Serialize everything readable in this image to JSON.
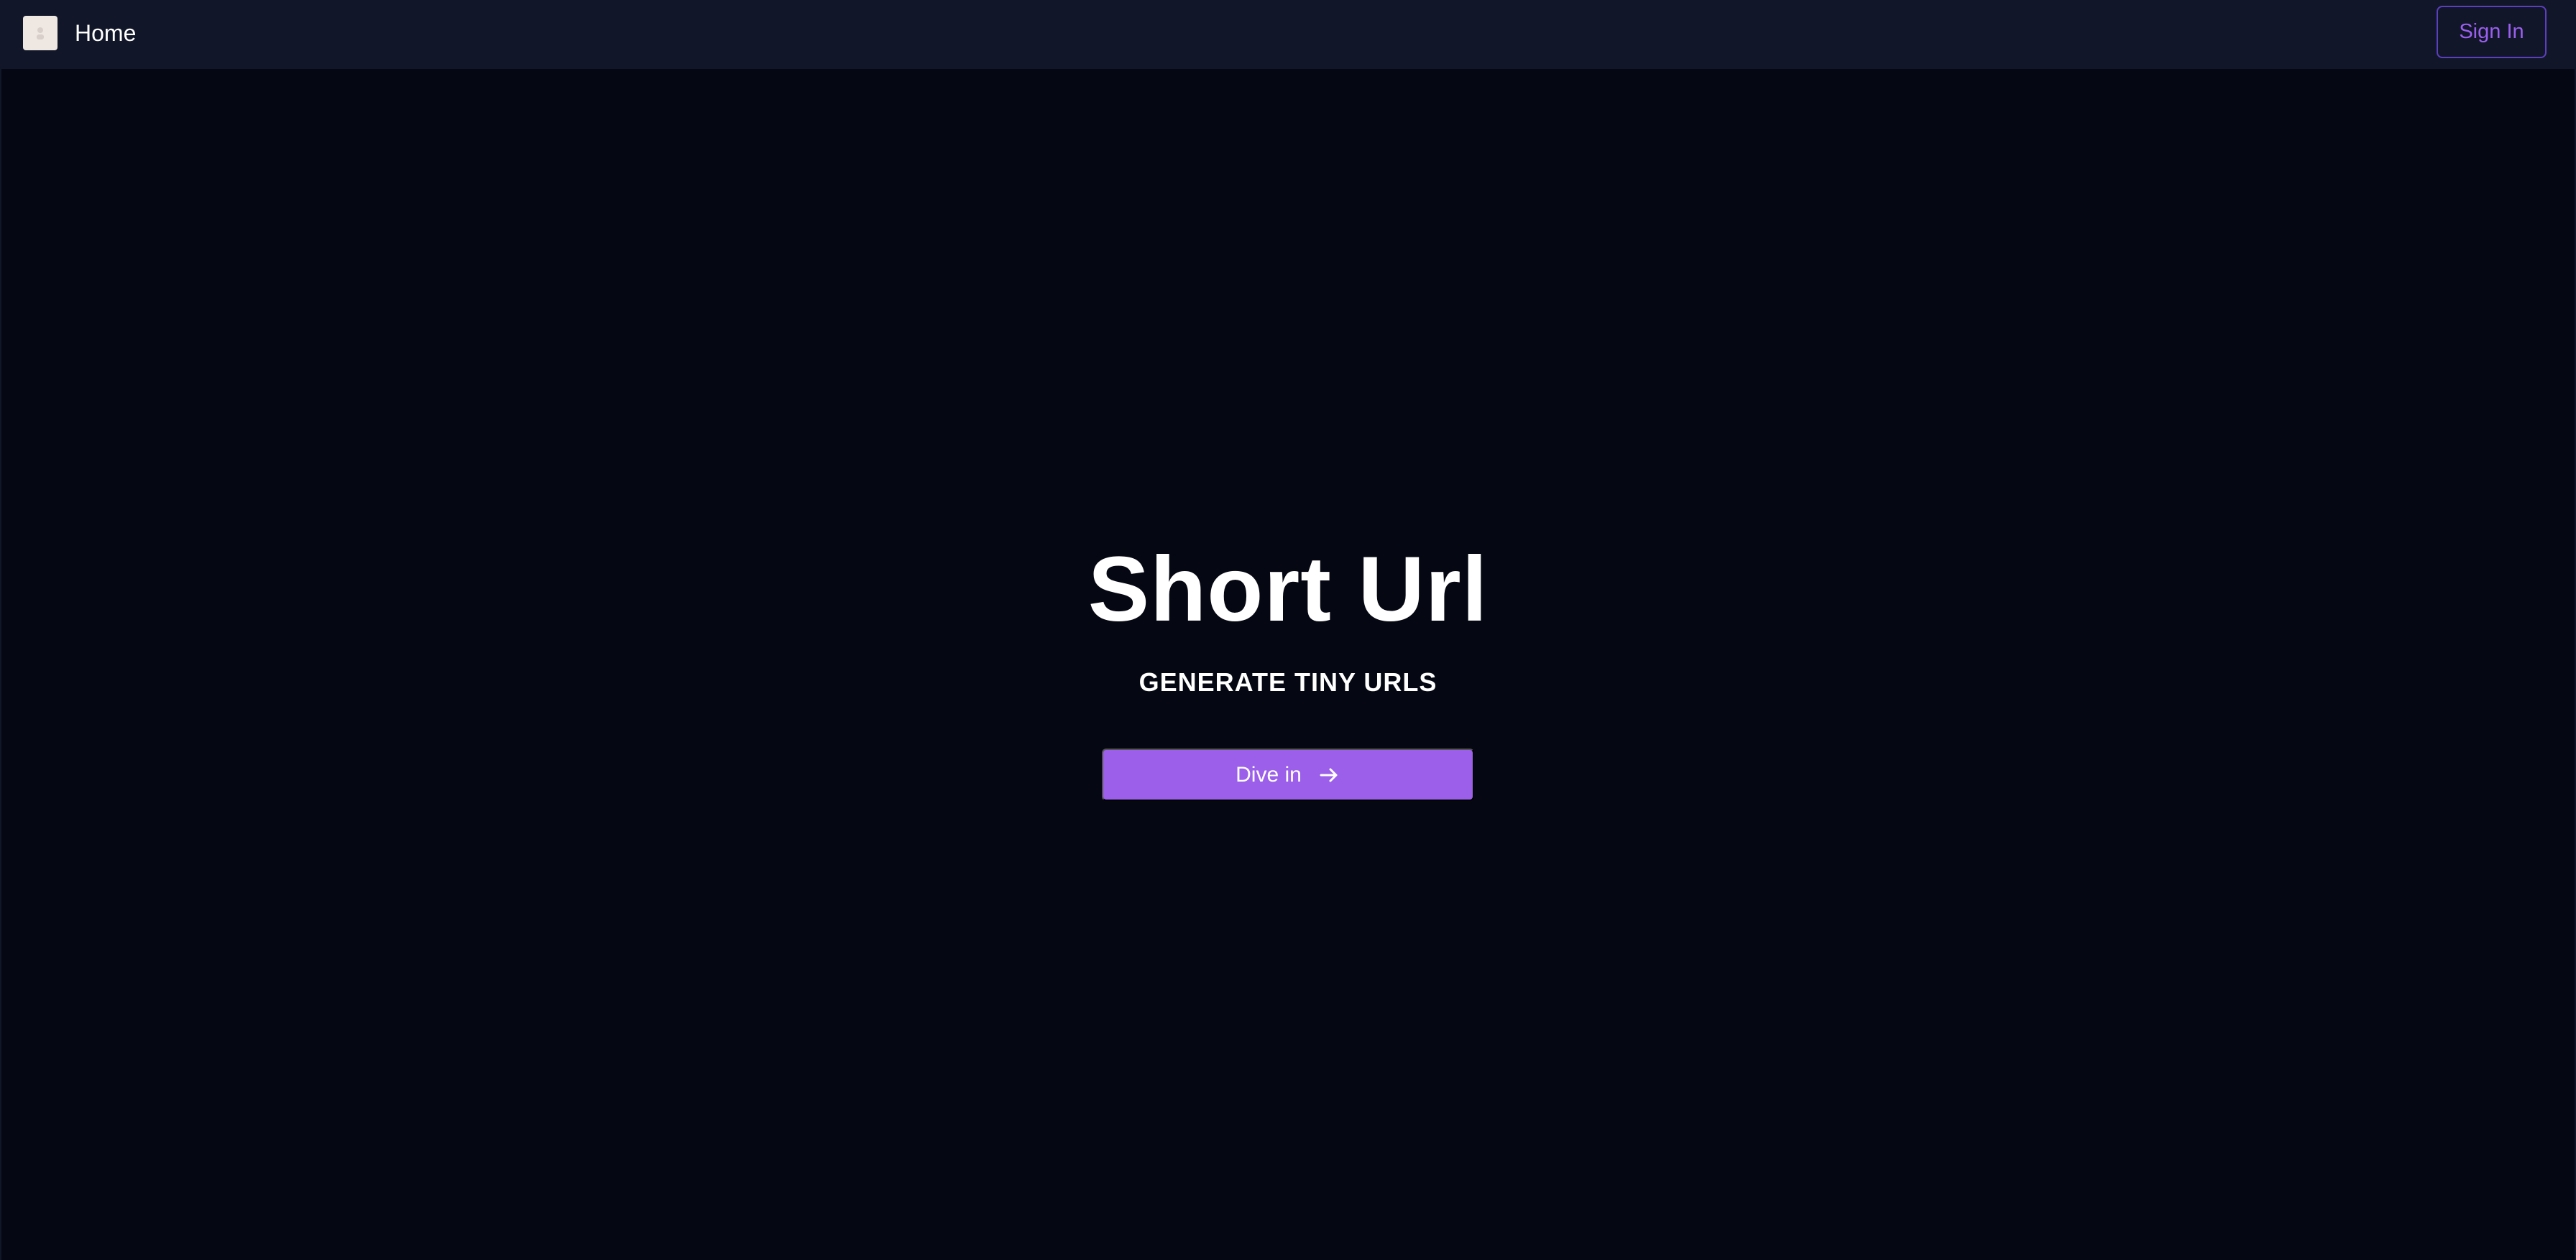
{
  "nav": {
    "home_label": "Home",
    "sign_in_label": "Sign In",
    "logo_icon": "app-logo-icon"
  },
  "hero": {
    "title": "Short Url",
    "subtitle": "GENERATE TINY URLS",
    "cta_label": "Dive in",
    "cta_icon": "arrow-right-icon"
  },
  "colors": {
    "background": "#050712",
    "navbar": "#111628",
    "accent": "#9b5fe9",
    "sign_in_border": "#5b3fbe",
    "sign_in_text": "#9b5ff0",
    "text": "#ffffff"
  }
}
